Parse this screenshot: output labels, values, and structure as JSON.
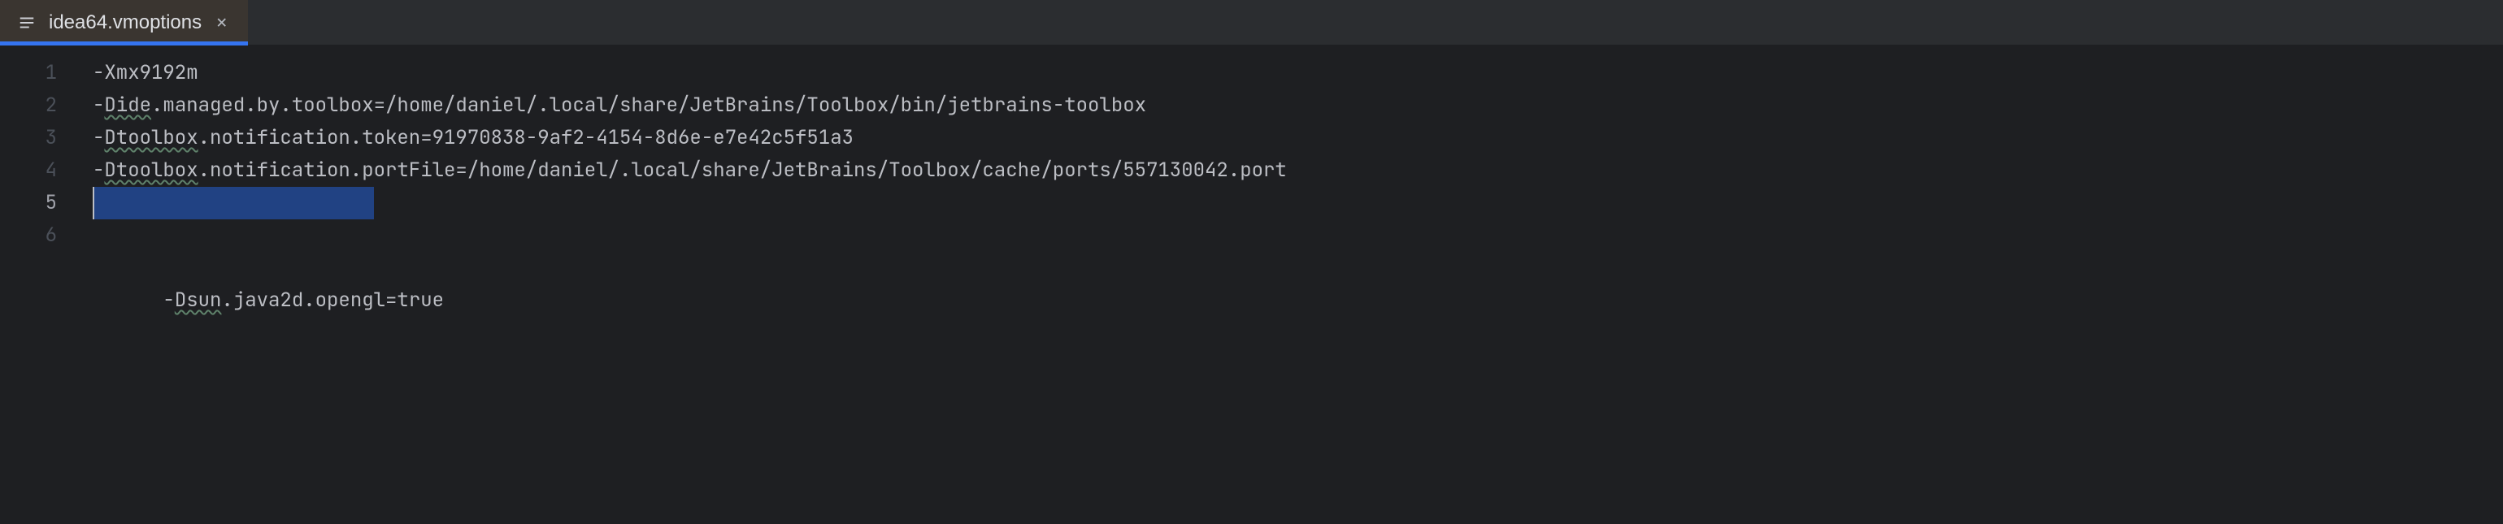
{
  "tab": {
    "filename": "idea64.vmoptions",
    "active": true
  },
  "editor": {
    "current_line": 5,
    "selection_line": 5,
    "selection_text": "-Dsun.java2d.opengl=true",
    "lines": [
      {
        "n": 1,
        "text": "-Xmx9192m"
      },
      {
        "n": 2,
        "prefix": "-",
        "typo": "Dide",
        "rest": ".managed.by.toolbox=/home/daniel/.local/share/JetBrains/Toolbox/bin/jetbrains-toolbox"
      },
      {
        "n": 3,
        "prefix": "-",
        "typo": "Dtoolbox",
        "rest": ".notification.token=91970838-9af2-4154-8d6e-e7e42c5f51a3"
      },
      {
        "n": 4,
        "prefix": "-",
        "typo": "Dtoolbox",
        "rest": ".notification.portFile=/home/daniel/.local/share/JetBrains/Toolbox/cache/ports/557130042.port"
      },
      {
        "n": 5,
        "prefix": "-",
        "typo": "Dsun",
        "rest": ".java2d.opengl=true"
      },
      {
        "n": 6,
        "text": ""
      }
    ]
  }
}
